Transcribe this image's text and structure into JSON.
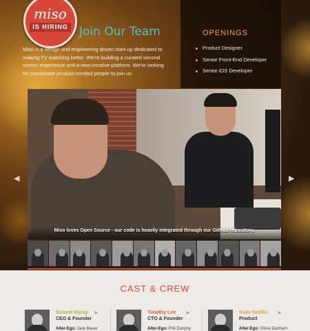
{
  "badge": {
    "brand": "miso",
    "tag": "IS HIRING"
  },
  "join": {
    "title": "Join Our Team",
    "intro": "Miso is a design and engineering driven start-up dedicated to making TV watching better. We're building a curated second screen experience and a new creative platform. We're looking for passionate product-minded people to join us."
  },
  "openings": {
    "title": "OPENINGS",
    "items": [
      {
        "label": "Product Designer"
      },
      {
        "label": "Senior Front-End Developer"
      },
      {
        "label": "Senior iOS Developer"
      }
    ]
  },
  "slideshow": {
    "caption": "Miso loves Open Source - our code is heavily integrated through our GitHub repository.",
    "prev_icon": "chevron-left-icon",
    "next_icon": "chevron-right-icon",
    "thumbnail_count": 12
  },
  "cast": {
    "title": "CAST & CREW",
    "members": [
      {
        "name": "Somrat Niyogi",
        "role": "CEO & Founder",
        "alter_label": "Alter-Ego:",
        "alter": "Jack Bauer",
        "name_color": "#a6b83a"
      },
      {
        "name": "Timothy Lee",
        "role": "CTO & Founder",
        "alter_label": "Alter-Ego:",
        "alter": "Phil Dunphy",
        "name_color": "#d9622e"
      },
      {
        "name": "Katie Smillie",
        "role": "Product",
        "alter_label": "Alter-Ego:",
        "alter": "Olivia Dunham",
        "name_color": "#e0a032"
      }
    ]
  },
  "colors": {
    "accent_teal": "#4fc6c2",
    "accent_orange": "#f0a64a",
    "accent_red": "#d84a37"
  }
}
